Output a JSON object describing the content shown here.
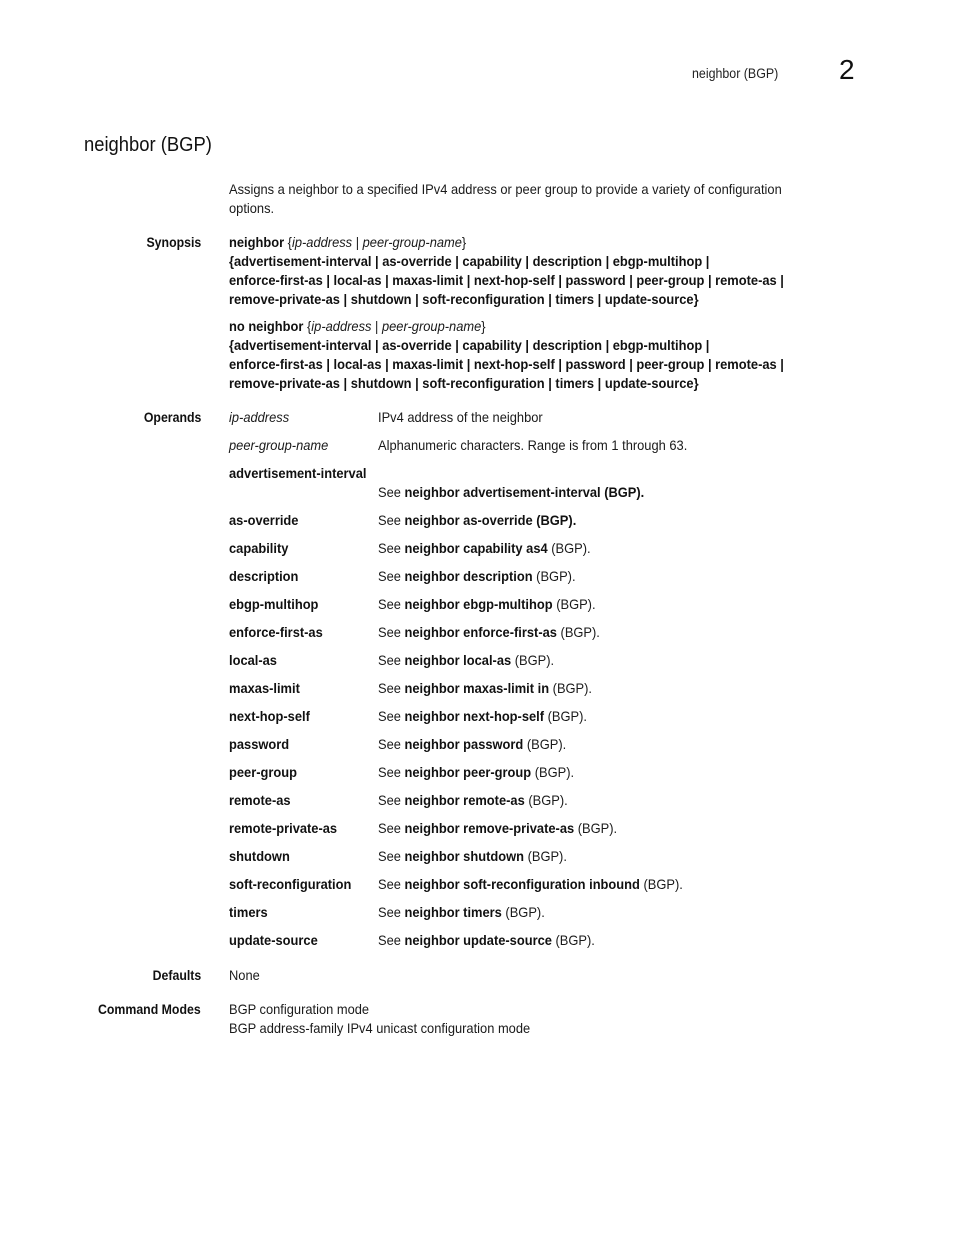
{
  "header": {
    "running_title": "neighbor (BGP)",
    "chapter_number": "2"
  },
  "page_title": "neighbor (BGP)",
  "description": [
    "Assigns a neighbor to a specified IPv4 address or peer group to provide a variety of configuration",
    "options."
  ],
  "sections": {
    "synopsis_label": "Synopsis",
    "operands_label": "Operands",
    "defaults_label": "Defaults",
    "command_modes_label": "Command Modes"
  },
  "synopsis": {
    "forms": [
      {
        "command": "neighbor",
        "args_open": "{",
        "arg1": "ip-address",
        "sep": " | ",
        "arg2": "peer-group-name",
        "args_close": "}",
        "lines": [
          "{advertisement-interval | as-override | capability | description | ebgp-multihop |",
          "enforce-first-as | local-as | maxas-limit | next-hop-self | password | peer-group | remote-as |",
          "remove-private-as | shutdown | soft-reconfiguration | timers | update-source}"
        ]
      },
      {
        "command": "no neighbor",
        "args_open": "{",
        "arg1": "ip-address",
        "sep": " | ",
        "arg2": "peer-group-name",
        "args_close": "}",
        "lines": [
          "{advertisement-interval | as-override | capability | description | ebgp-multihop |",
          "enforce-first-as | local-as | maxas-limit | next-hop-self | password | peer-group | remote-as |",
          "remove-private-as | shutdown | soft-reconfiguration | timers | update-source}"
        ]
      }
    ]
  },
  "operands": [
    {
      "term": "ip-address",
      "italic": true,
      "definition": "IPv4 address of the neighbor"
    },
    {
      "term": "peer-group-name",
      "italic": true,
      "definition": "Alphanumeric characters. Range is from 1 through 63."
    },
    {
      "term": "advertisement-interval",
      "see_prefix": "See ",
      "see_ref": "neighbor advertisement-interval (BGP)."
    },
    {
      "term": "as-override",
      "see_prefix": "See ",
      "see_ref": "neighbor as-override (BGP)."
    },
    {
      "term": "capability",
      "see_prefix": "See ",
      "see_ref": "neighbor capability  as4",
      "see_suffix": " (BGP)."
    },
    {
      "term": "description",
      "see_prefix": "See ",
      "see_ref": "neighbor description",
      "see_suffix": " (BGP)."
    },
    {
      "term": "ebgp-multihop",
      "see_prefix": "See ",
      "see_ref": "neighbor ebgp-multihop",
      "see_suffix": " (BGP)."
    },
    {
      "term": "enforce-first-as",
      "see_prefix": "See ",
      "see_ref": "neighbor enforce-first-as",
      "see_suffix": " (BGP)."
    },
    {
      "term": "local-as",
      "see_prefix": "See ",
      "see_ref": "neighbor local-as",
      "see_suffix": " (BGP)."
    },
    {
      "term": "maxas-limit",
      "see_prefix": "See ",
      "see_ref": "neighbor maxas-limit in",
      "see_suffix": " (BGP)."
    },
    {
      "term": "next-hop-self",
      "see_prefix": "See ",
      "see_ref": "neighbor next-hop-self",
      "see_suffix": " (BGP)."
    },
    {
      "term": "password",
      "see_prefix": "See ",
      "see_ref": "neighbor password",
      "see_suffix": " (BGP)."
    },
    {
      "term": "peer-group",
      "see_prefix": "See ",
      "see_ref": "neighbor peer-group",
      "see_suffix": " (BGP)."
    },
    {
      "term": "remote-as",
      "see_prefix": "See ",
      "see_ref": "neighbor remote-as",
      "see_suffix": " (BGP)."
    },
    {
      "term": "remote-private-as",
      "see_prefix": "See ",
      "see_ref": "neighbor remove-private-as",
      "see_suffix": " (BGP)."
    },
    {
      "term": "shutdown",
      "see_prefix": "See ",
      "see_ref": "neighbor shutdown",
      "see_suffix": " (BGP)."
    },
    {
      "term": "soft-reconfiguration",
      "see_prefix": "See ",
      "see_ref": "neighbor soft-reconfiguration inbound",
      "see_suffix": " (BGP)."
    },
    {
      "term": "timers",
      "see_prefix": "See ",
      "see_ref": "neighbor timers ",
      "see_suffix": " (BGP)."
    },
    {
      "term": "update-source",
      "see_prefix": "See ",
      "see_ref": "neighbor update-source",
      "see_suffix": " (BGP)."
    }
  ],
  "defaults": "None",
  "command_modes": [
    "BGP configuration mode",
    "BGP address-family IPv4 unicast configuration mode"
  ]
}
